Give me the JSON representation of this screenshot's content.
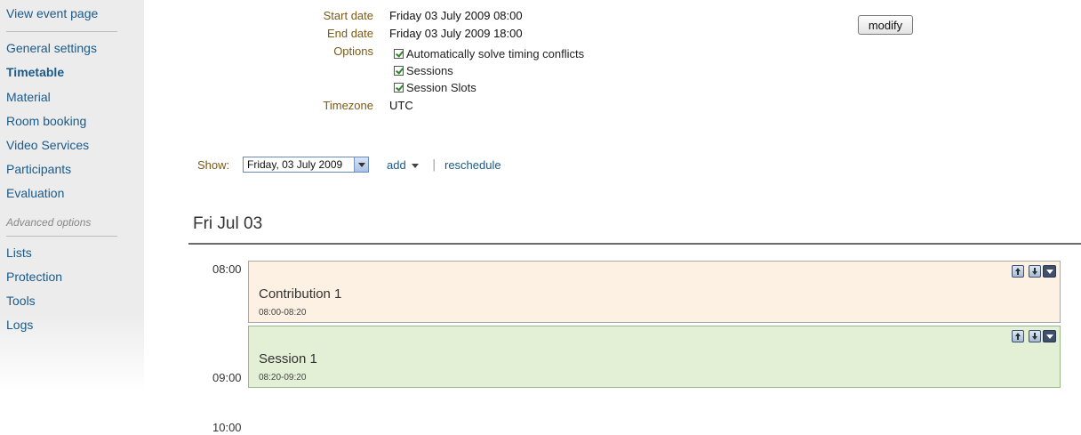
{
  "sidebar": {
    "view_event_page": "View event page",
    "items": [
      {
        "label": "General settings"
      },
      {
        "label": "Timetable"
      },
      {
        "label": "Material"
      },
      {
        "label": "Room booking"
      },
      {
        "label": "Video Services"
      },
      {
        "label": "Participants"
      },
      {
        "label": "Evaluation"
      }
    ],
    "advanced_header": "Advanced options",
    "advanced_items": [
      {
        "label": "Lists"
      },
      {
        "label": "Protection"
      },
      {
        "label": "Tools"
      },
      {
        "label": "Logs"
      }
    ],
    "active": "Timetable"
  },
  "info": {
    "start_date_label": "Start date",
    "start_date_value": "Friday 03 July 2009 08:00",
    "end_date_label": "End date",
    "end_date_value": "Friday 03 July 2009 18:00",
    "options_label": "Options",
    "options": [
      {
        "label": "Automatically solve timing conflicts",
        "checked": true
      },
      {
        "label": "Sessions",
        "checked": true
      },
      {
        "label": "Session Slots",
        "checked": true
      }
    ],
    "timezone_label": "Timezone",
    "timezone_value": "UTC",
    "modify_label": "modify"
  },
  "toolbar": {
    "show_label": "Show:",
    "show_value": "Friday, 03 July 2009",
    "add_label": "add",
    "separator": "|",
    "reschedule_label": "reschedule"
  },
  "day": {
    "title": "Fri Jul 03",
    "hours": [
      "08:00",
      "09:00",
      "10:00"
    ],
    "entries": [
      {
        "title": "Contribution 1",
        "time": "08:00-08:20",
        "type": "contribution",
        "color": "#fdf1e3"
      },
      {
        "title": "Session 1",
        "time": "08:20-09:20",
        "type": "session",
        "color": "#e3f0d6"
      }
    ]
  }
}
